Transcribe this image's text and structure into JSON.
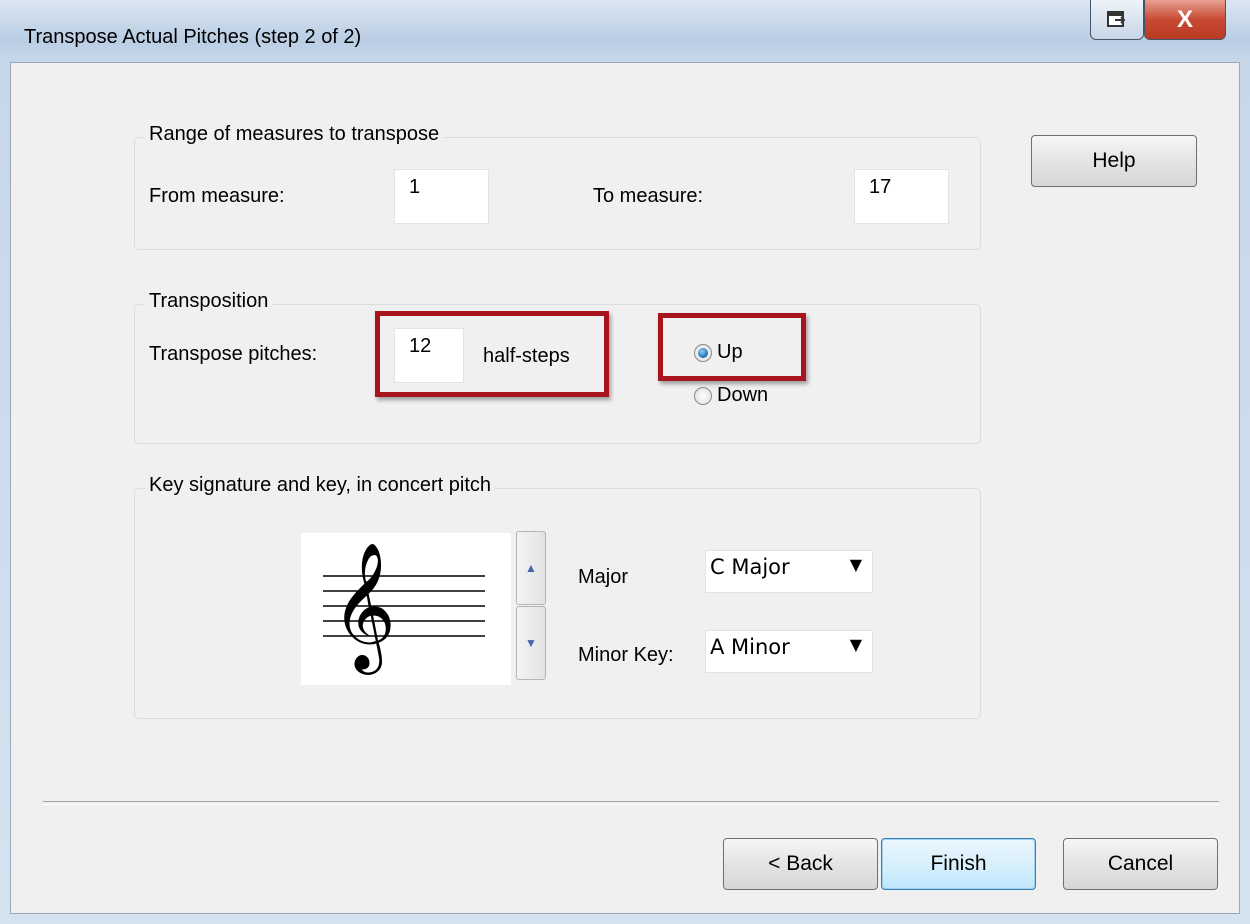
{
  "window": {
    "title": "Transpose Actual Pitches (step 2 of 2)",
    "restore_icon": "restore-icon",
    "close_label": "X"
  },
  "range": {
    "group_label": "Range of measures to transpose",
    "from_label": "From measure:",
    "from_value": "1",
    "to_label": "To measure:",
    "to_value": "17"
  },
  "transposition": {
    "group_label": "Transposition",
    "pitches_label": "Transpose pitches:",
    "pitches_value": "12",
    "unit_label": "half-steps",
    "direction_options": [
      {
        "label": "Up",
        "selected": true
      },
      {
        "label": "Down",
        "selected": false
      }
    ]
  },
  "key": {
    "group_label": "Key signature and key, in concert pitch",
    "clef_icon": "treble-clef-icon",
    "major_label": "Major",
    "major_value": "C Major",
    "minor_label": "Minor Key:",
    "minor_value": "A Minor"
  },
  "buttons": {
    "help": "Help",
    "back": "< Back",
    "finish": "Finish",
    "cancel": "Cancel"
  },
  "colors": {
    "highlight": "#a8141b",
    "dialog_bg": "#f0f0f0",
    "close_button": "#c84a34"
  }
}
